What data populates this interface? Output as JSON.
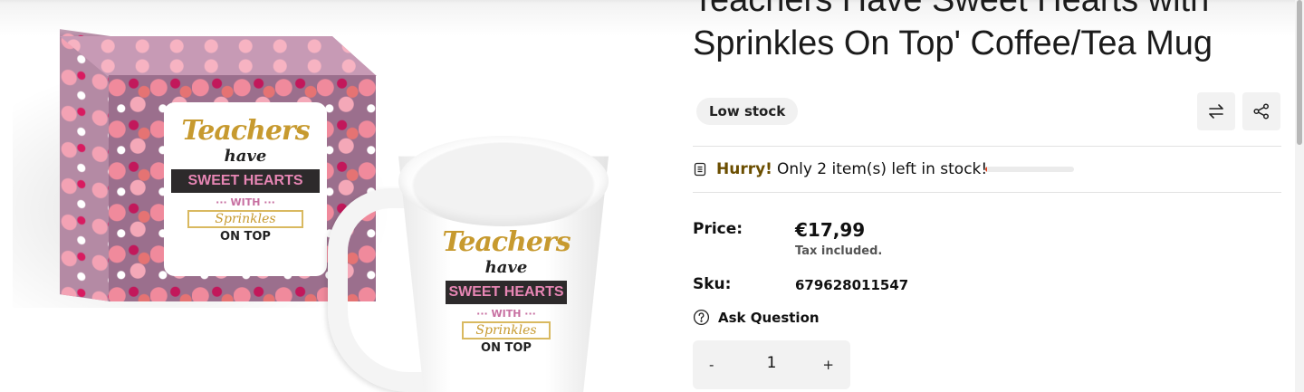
{
  "product": {
    "title": "Teachers Have Sweet Hearts with Sprinkles On Top' Coffee/Tea Mug",
    "stock_badge": "Low stock",
    "stock_alert": {
      "hurry": "Hurry!",
      "message": "Only 2 item(s) left in stock!",
      "level_fraction": 0.02
    },
    "price_label": "Price:",
    "price_value": "€17,99",
    "tax_note": "Tax included.",
    "sku_label": "Sku:",
    "sku_value": "679628011547",
    "ask_question": "Ask Question",
    "quantity": {
      "minus": "-",
      "value": "1",
      "plus": "+"
    }
  },
  "actions": {
    "compare_icon": "compare-arrows-icon",
    "share_icon": "share-icon"
  },
  "image": {
    "label_teachers": "Teachers",
    "label_have": "have",
    "label_sweet": "SWEET HEARTS",
    "label_with": "··· WITH ···",
    "label_sprinkles": "Sprinkles",
    "label_ontop": "ON TOP"
  },
  "colors": {
    "hurry": "#6b4e00",
    "progress_fill": "#e0401c",
    "badge_bg": "#f1f1f1"
  }
}
